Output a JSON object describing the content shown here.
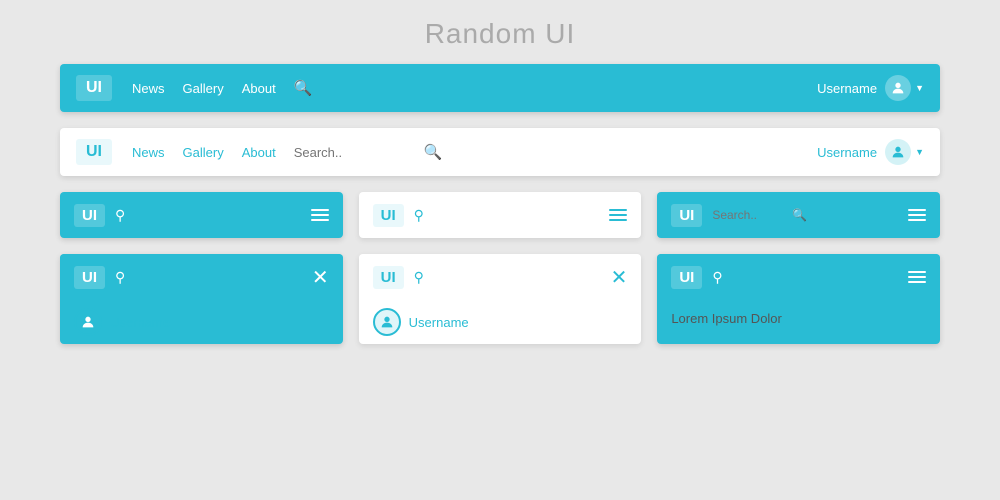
{
  "page": {
    "title": "Random UI"
  },
  "navbar1": {
    "brand": "UI",
    "links": [
      "News",
      "Gallery",
      "About"
    ],
    "username": "Username",
    "search_icon": "🔍",
    "user_icon": "👤"
  },
  "navbar2": {
    "brand": "UI",
    "links": [
      "News",
      "Gallery",
      "About"
    ],
    "search_placeholder": "Search..",
    "username": "Username",
    "search_icon": "🔍",
    "user_icon": "👤"
  },
  "small_navs": [
    {
      "brand": "UI",
      "type": "blue"
    },
    {
      "brand": "UI",
      "type": "white"
    },
    {
      "brand": "UI",
      "type": "blue_search",
      "search_placeholder": "Search.."
    }
  ],
  "small_navs2": [
    {
      "brand": "UI",
      "type": "blue"
    },
    {
      "brand": "UI",
      "type": "white"
    },
    {
      "brand": "UI",
      "type": "blue"
    }
  ],
  "card3": {
    "username": "Username",
    "lorem": "Lorem Ipsum Dolor"
  }
}
